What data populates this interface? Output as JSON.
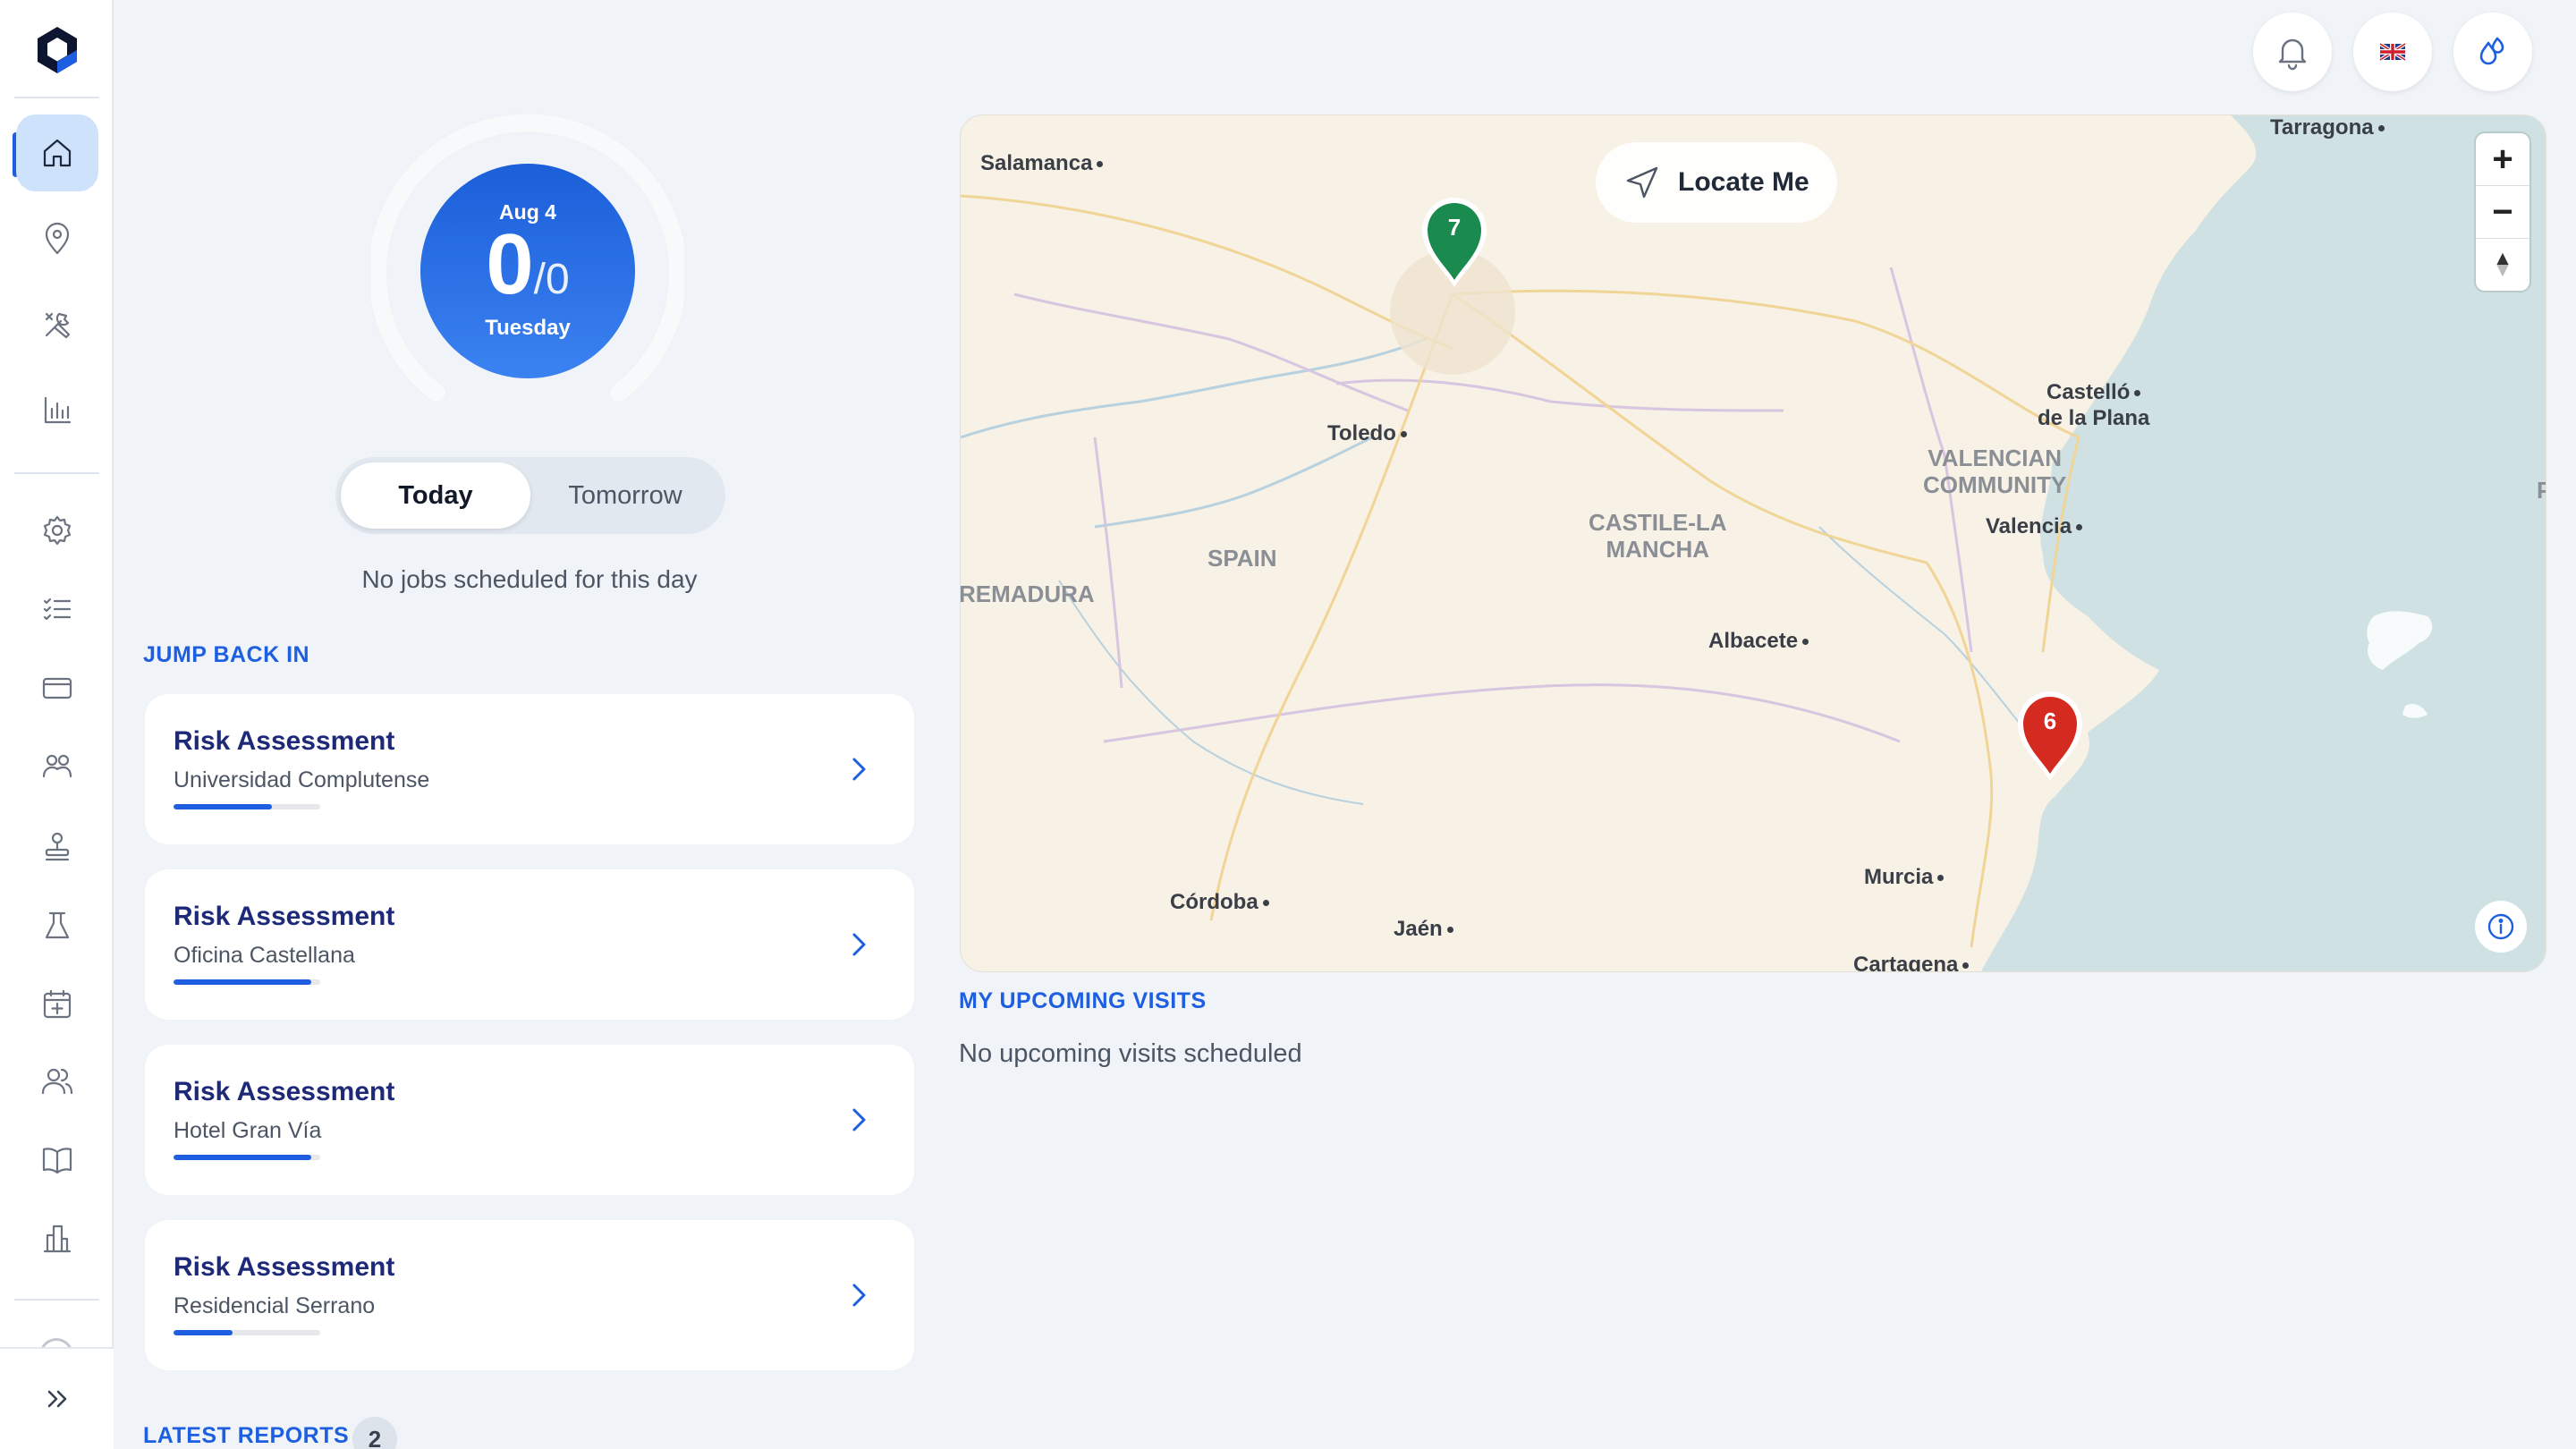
{
  "sidebar": {
    "items": [
      {
        "name": "home-icon",
        "active": true
      },
      {
        "name": "location-pin-icon"
      },
      {
        "name": "tools-icon"
      },
      {
        "name": "bar-chart-icon"
      },
      {
        "name": "settings-gear-icon"
      },
      {
        "name": "checklist-icon"
      },
      {
        "name": "credit-card-icon"
      },
      {
        "name": "team-icon"
      },
      {
        "name": "stamp-icon"
      },
      {
        "name": "flask-icon"
      },
      {
        "name": "calendar-plus-icon"
      },
      {
        "name": "users-icon"
      },
      {
        "name": "book-icon"
      },
      {
        "name": "building-icon"
      }
    ],
    "expand_icon": "chevrons-right-icon"
  },
  "topbar": {
    "buttons": [
      "bell-icon",
      "uk-flag-icon",
      "drops-icon"
    ]
  },
  "schedule": {
    "date": "Aug 4",
    "count": "0",
    "denominator": "/0",
    "weekday": "Tuesday",
    "progress": 0,
    "toggle": {
      "today": "Today",
      "tomorrow": "Tomorrow",
      "selected": "Today"
    },
    "empty_text": "No jobs scheduled for this day"
  },
  "jump_back_in": {
    "title": "JUMP BACK IN",
    "cards": [
      {
        "title": "Risk Assessment",
        "subtitle": "Universidad Complutense",
        "progress": 0.67
      },
      {
        "title": "Risk Assessment",
        "subtitle": "Oficina Castellana",
        "progress": 0.94
      },
      {
        "title": "Risk Assessment",
        "subtitle": "Hotel Gran Vía",
        "progress": 0.94
      },
      {
        "title": "Risk Assessment",
        "subtitle": "Residencial Serrano",
        "progress": 0.4
      }
    ]
  },
  "latest_reports": {
    "title": "LATEST REPORTS",
    "count": "2"
  },
  "map": {
    "locate_label": "Locate Me",
    "zoom_in": "+",
    "zoom_out": "−",
    "cities": {
      "salamanca": "Salamanca",
      "tarragona": "Tarragona",
      "toledo": "Toledo",
      "castello": "Castelló",
      "castello2": "de la Plana",
      "valencia": "Valencia",
      "albacete": "Albacete",
      "cordoba": "Córdoba",
      "jaen": "Jaén",
      "murcia": "Murcia",
      "cartagena": "Cartagena"
    },
    "regions": {
      "spain": "SPAIN",
      "extremadura": "REMADURA",
      "castile": "CASTILE-LA",
      "castile2": "MANCHA",
      "valencian": "VALENCIAN",
      "valencian2": "COMMUNITY",
      "edge": "P"
    },
    "pins": [
      {
        "label": "7",
        "color": "#1a8a4f"
      },
      {
        "label": "6",
        "color": "#d42a20"
      }
    ]
  },
  "upcoming": {
    "title": "MY UPCOMING VISITS",
    "empty_text": "No upcoming visits scheduled"
  }
}
